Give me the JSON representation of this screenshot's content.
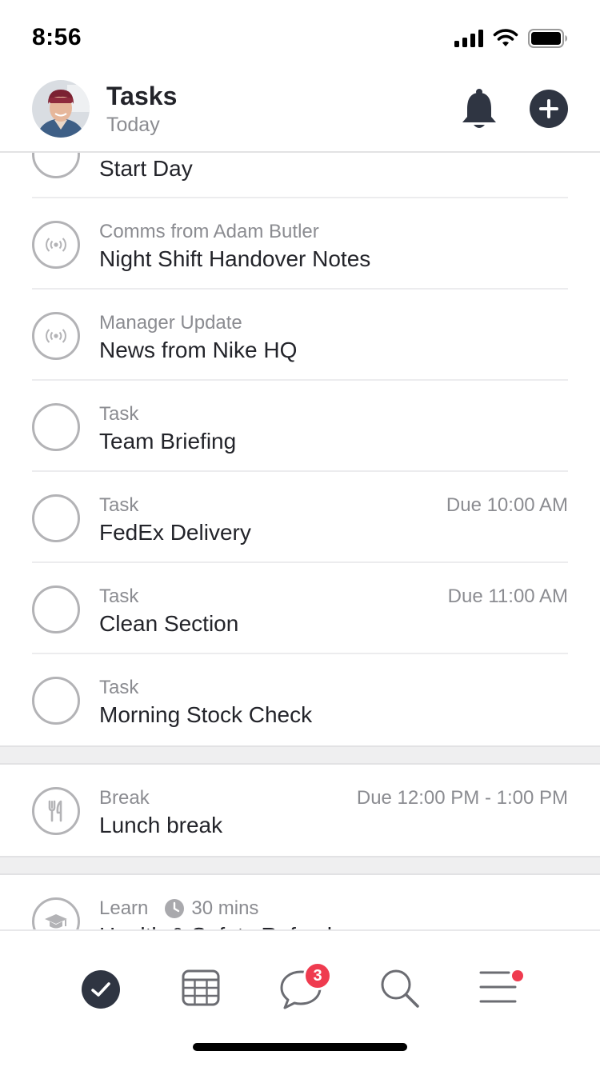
{
  "status_bar": {
    "time": "8:56"
  },
  "header": {
    "title": "Tasks",
    "subtitle": "Today"
  },
  "items": [
    {
      "title": "Start Day",
      "icon": "circle"
    },
    {
      "category": "Comms from Adam Butler",
      "title": "Night Shift Handover Notes",
      "icon": "broadcast-icon"
    },
    {
      "category": "Manager Update",
      "title": "News from Nike HQ",
      "icon": "broadcast-icon"
    },
    {
      "category": "Task",
      "title": "Team Briefing",
      "icon": "circle"
    },
    {
      "category": "Task",
      "title": "FedEx Delivery",
      "due": "Due 10:00 AM",
      "icon": "circle"
    },
    {
      "category": "Task",
      "title": "Clean Section",
      "due": "Due 11:00 AM",
      "icon": "circle"
    },
    {
      "category": "Task",
      "title": "Morning Stock Check",
      "icon": "circle"
    }
  ],
  "break_item": {
    "category": "Break",
    "title": "Lunch break",
    "due": "Due 12:00 PM - 1:00 PM",
    "icon": "fork-knife-icon"
  },
  "learn_item": {
    "category": "Learn",
    "duration": "30 mins",
    "title": "Health & Safety Refresher",
    "icon": "graduation-cap-icon"
  },
  "tabbar": {
    "messages_badge": "3",
    "accent": "#2f3542",
    "badge_color": "#ef3b4f"
  }
}
